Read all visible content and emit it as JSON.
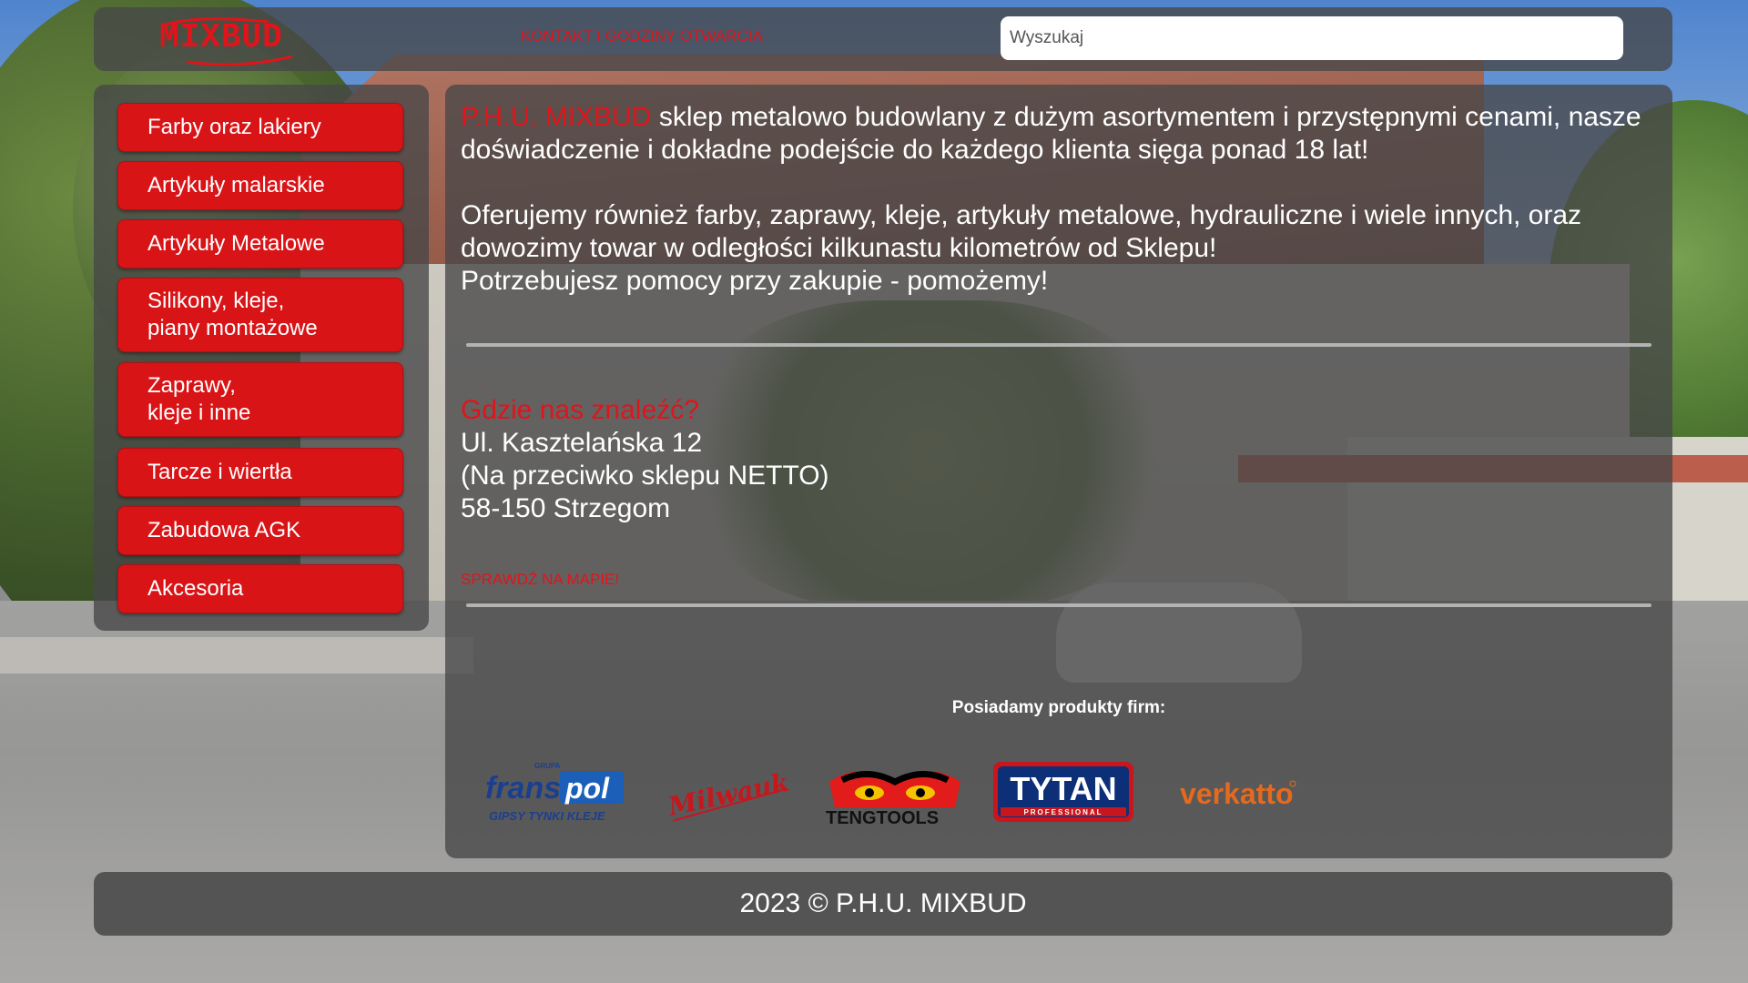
{
  "header": {
    "logo_text": "MIXBUD",
    "nav_link": "KONTAKT I GODZINY OTWARCIA",
    "search_placeholder": "Wyszukaj"
  },
  "sidebar": {
    "items": [
      {
        "label": "Farby oraz lakiery"
      },
      {
        "label": "Artykuły malarskie"
      },
      {
        "label": "Artykuły Metalowe"
      },
      {
        "label": "Silikony, kleje,\npiany montażowe"
      },
      {
        "label": "Zaprawy,\nkleje i inne"
      },
      {
        "label": "Tarcze i wiertła"
      },
      {
        "label": "Zabudowa AGK"
      },
      {
        "label": "Akcesoria"
      }
    ]
  },
  "main": {
    "intro_brand": "P.H.U. MIXBUD",
    "intro_text": " sklep metalowo budowlany z dużym asortymentem i przystępnymi cenami, nasze doświadczenie i dokładne podejście do każdego klienta sięga ponad 18 lat!",
    "para2": "Oferujemy również farby, zaprawy, kleje, artykuły metalowe, hydrauliczne i wiele innych, oraz dowozimy towar w odległości kilkunastu kilometrów od Sklepu!",
    "para3": "Potrzebujesz pomocy przy zakupie - pomożemy!",
    "find_title": "Gdzie nas znaleźć?",
    "address": {
      "line1": "Ul. Kasztelańska 12",
      "line2": "(Na przeciwko sklepu NETTO)",
      "line3": "58-150 Strzegom"
    },
    "map_link": "SPRAWDŹ NA MAPIE!",
    "brands_title": "Posiadamy produkty firm:",
    "brands": {
      "franspol_group": "GRUPA",
      "franspol_name_1": "frans",
      "franspol_name_2": "pol",
      "franspol_tagline": "GIPSY  TYNKI  KLEJE",
      "milwaukee": "Milwaukee",
      "tengtools": "TENGTOOLS",
      "tytan": "TYTAN",
      "tytan_sub": "PROFESSIONAL",
      "verkatto": "verkatto"
    }
  },
  "footer": {
    "text": "2023 © P.H.U. MIXBUD"
  },
  "colors": {
    "accent": "#e0141b",
    "button": "#d91417",
    "panel": "rgba(70,70,72,0.78)"
  }
}
